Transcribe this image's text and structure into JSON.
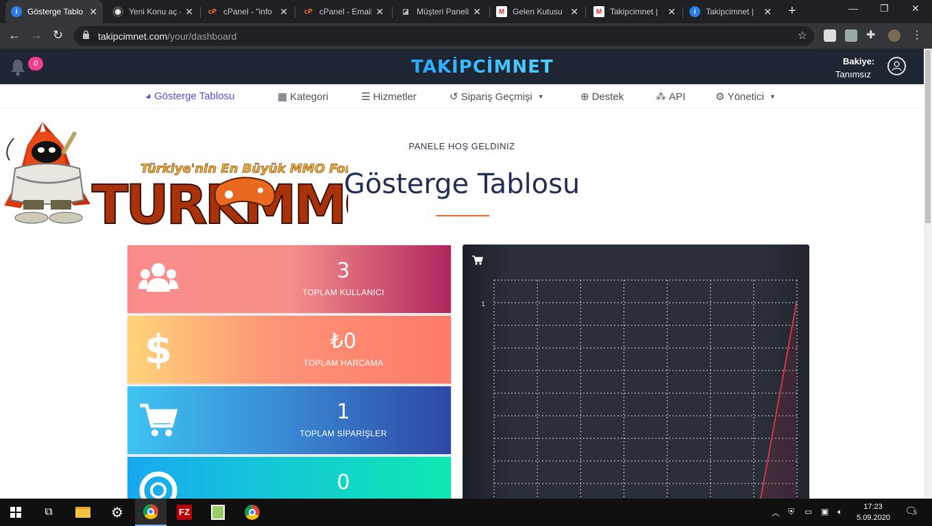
{
  "browser": {
    "tabs": [
      {
        "title": "Gösterge Tablo",
        "icon": "info-icon",
        "active": true
      },
      {
        "title": "Yeni Konu aç -",
        "icon": "spy-icon"
      },
      {
        "title": "cPanel - \"info",
        "icon": "cpanel-icon"
      },
      {
        "title": "cPanel - Email",
        "icon": "cpanel-icon"
      },
      {
        "title": "Müşteri Paneli",
        "icon": "whm-icon"
      },
      {
        "title": "Gelen Kutusu",
        "icon": "gmail-icon"
      },
      {
        "title": "Takipcimnet | ",
        "icon": "gmail-icon"
      },
      {
        "title": "Takipcimnet | ",
        "icon": "info-icon"
      }
    ],
    "url_host": "takipcimnet.com",
    "url_path": "/your/dashboard"
  },
  "header": {
    "brand": "TAKİPCİMNET",
    "notification_count": "0",
    "balance_label": "Bakiye:",
    "balance_value": "Tanımsız"
  },
  "nav": {
    "items": [
      {
        "label": "Gösterge Tablosu",
        "icon": "dashboard-icon"
      },
      {
        "label": "Kategori",
        "icon": "table-icon"
      },
      {
        "label": "Hizmetler",
        "icon": "list-icon"
      },
      {
        "label": "Sipariş Geçmişi",
        "icon": "history-icon"
      },
      {
        "label": "Destek",
        "icon": "lifebuoy-icon"
      },
      {
        "label": "API",
        "icon": "cubes-icon"
      },
      {
        "label": "Yönetici",
        "icon": "gear-icon"
      }
    ]
  },
  "hero": {
    "welcome": "PANELE HOŞ GELDINIZ",
    "title": "Gösterge Tablosu",
    "banner_text": "Türkiye'nin En Büyük MMO Forumu",
    "banner_logo": "TURKMMO"
  },
  "stats": [
    {
      "value": "3",
      "label": "TOPLAM KULLANICI",
      "icon": "users-icon"
    },
    {
      "value": "₺0",
      "label": "TOPLAM HARCAMA",
      "icon": "dollar-icon"
    },
    {
      "value": "1",
      "label": "TOPLAM SİPARİŞLER",
      "icon": "cart-icon"
    },
    {
      "value": "0",
      "label": "",
      "icon": "lifebuoy-icon"
    }
  ],
  "chart_data": {
    "type": "line",
    "title": "",
    "y_tick": "1",
    "ylim": [
      0,
      1
    ],
    "series": [
      {
        "values": [
          0,
          1
        ]
      }
    ],
    "grid": true
  },
  "taskbar": {
    "time": "17:23",
    "date": "5.09.2020",
    "notifications": "5"
  }
}
